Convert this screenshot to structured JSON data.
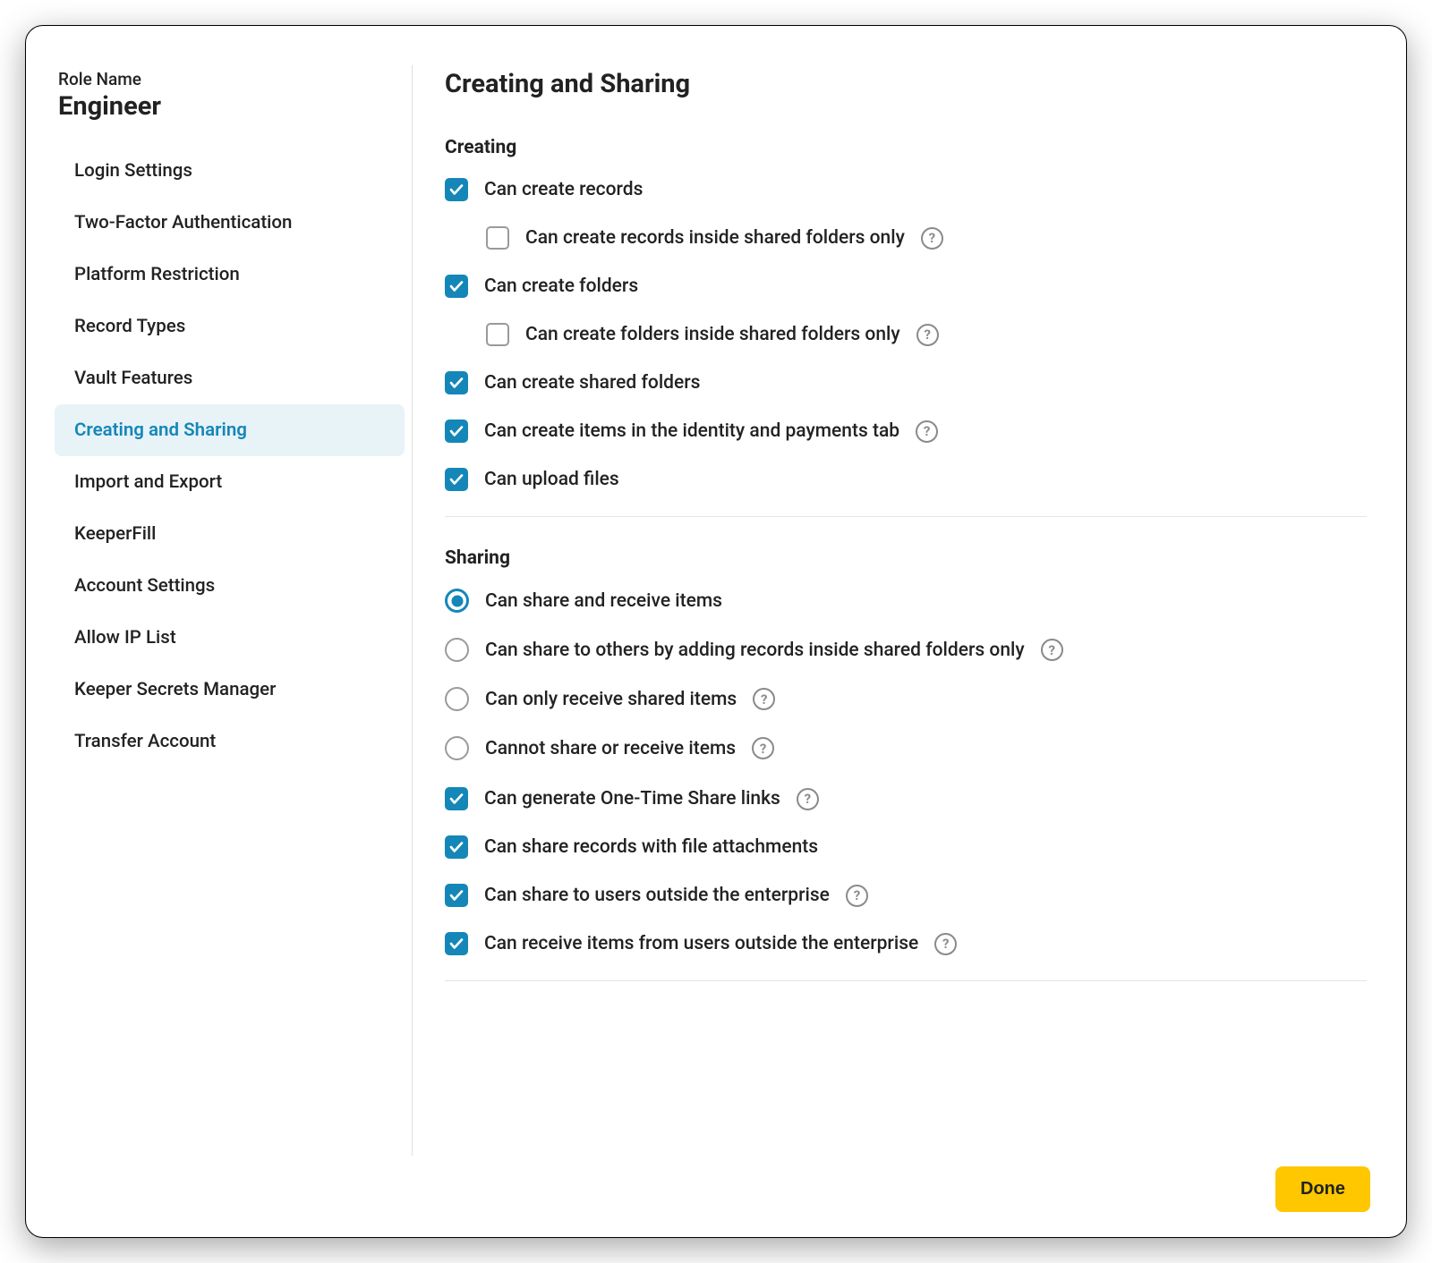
{
  "colors": {
    "accent": "#1487b8",
    "accent_bg": "#e8f3f8",
    "done_bg": "#ffc700"
  },
  "sidebar": {
    "kicker": "Role Name",
    "role": "Engineer",
    "items": [
      {
        "label": "Login Settings"
      },
      {
        "label": "Two-Factor Authentication"
      },
      {
        "label": "Platform Restriction"
      },
      {
        "label": "Record Types"
      },
      {
        "label": "Vault Features"
      },
      {
        "label": "Creating and Sharing",
        "active": true
      },
      {
        "label": "Import and Export"
      },
      {
        "label": "KeeperFill"
      },
      {
        "label": "Account Settings"
      },
      {
        "label": "Allow IP List"
      },
      {
        "label": "Keeper Secrets Manager"
      },
      {
        "label": "Transfer Account"
      }
    ]
  },
  "page": {
    "title": "Creating and Sharing"
  },
  "creating": {
    "title": "Creating",
    "options": [
      {
        "label": "Can create records",
        "checked": true
      },
      {
        "label": "Can create records inside shared folders only",
        "checked": false,
        "indent": true,
        "help": true
      },
      {
        "label": "Can create folders",
        "checked": true
      },
      {
        "label": "Can create folders inside shared folders only",
        "checked": false,
        "indent": true,
        "help": true
      },
      {
        "label": "Can create shared folders",
        "checked": true
      },
      {
        "label": "Can create items in the identity and payments tab",
        "checked": true,
        "help": true
      },
      {
        "label": "Can upload files",
        "checked": true
      }
    ]
  },
  "sharing": {
    "title": "Sharing",
    "radios": [
      {
        "label": "Can share and receive items",
        "selected": true
      },
      {
        "label": "Can share to others by adding records inside shared folders only",
        "selected": false,
        "help": true
      },
      {
        "label": "Can only receive shared items",
        "selected": false,
        "help": true
      },
      {
        "label": "Cannot share or receive items",
        "selected": false,
        "help": true
      }
    ],
    "checks": [
      {
        "label": "Can generate One-Time Share links",
        "checked": true,
        "help": true
      },
      {
        "label": "Can share records with file attachments",
        "checked": true
      },
      {
        "label": "Can share to users outside the enterprise",
        "checked": true,
        "help": true
      },
      {
        "label": "Can receive items from users outside the enterprise",
        "checked": true,
        "help": true
      }
    ]
  },
  "footer": {
    "done": "Done"
  }
}
